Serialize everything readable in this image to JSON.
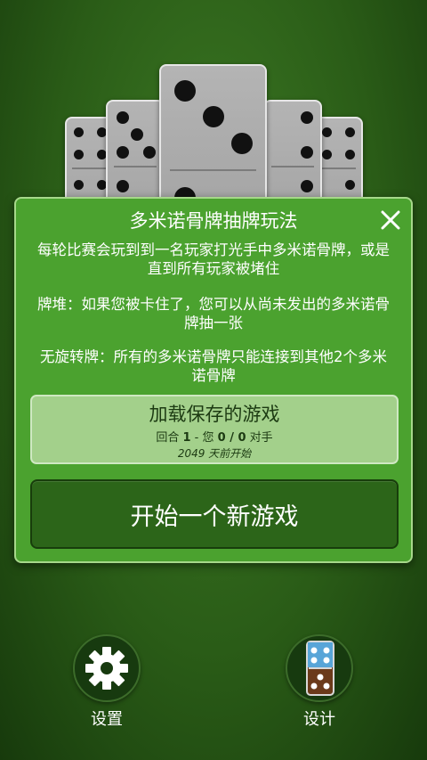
{
  "panel": {
    "title": "多米诺骨牌抽牌玩法",
    "rules": [
      "每轮比赛会玩到到一名玩家打光手中多米诺骨牌，或是直到所有玩家被堵住",
      "牌堆：如果您被卡住了，您可以从尚未发出的多米诺骨牌抽一张",
      "无旋转牌：所有的多米诺骨牌只能连接到其他2个多米诺骨牌"
    ],
    "close_icon": "close-icon"
  },
  "load_game": {
    "title": "加载保存的游戏",
    "round_prefix": "回合",
    "round_number": "1",
    "separator": " - 您 ",
    "score": "0 / 0",
    "opponent": " 对手",
    "started": "2049 天前开始"
  },
  "new_game": {
    "label": "开始一个新游戏"
  },
  "bottom_bar": {
    "settings_label": "设置",
    "settings_icon": "gear-icon",
    "design_label": "设计",
    "design_icon": "domino-icon"
  },
  "colors": {
    "panel": "#4ba22f",
    "load_button": "#a3d08b",
    "new_game_button": "#2c6519",
    "background": "#2a5c17"
  }
}
